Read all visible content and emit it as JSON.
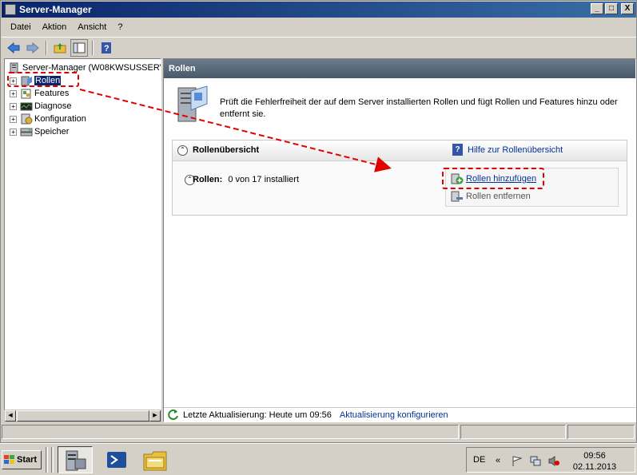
{
  "window": {
    "title": "Server-Manager",
    "controls": {
      "minimize": "_",
      "maximize": "□",
      "close": "X"
    }
  },
  "menu": {
    "items": [
      "Datei",
      "Aktion",
      "Ansicht",
      "?"
    ]
  },
  "toolbar": {
    "icons": [
      "back-arrow-icon",
      "forward-arrow-icon",
      "up-folder-icon",
      "console-tree-icon",
      "help-icon"
    ]
  },
  "tree": {
    "root": "Server-Manager (W08KWSUSSERV",
    "items": [
      {
        "label": "Rollen",
        "icon": "roles-icon",
        "expander": "+",
        "selected": true
      },
      {
        "label": "Features",
        "icon": "features-icon",
        "expander": "+"
      },
      {
        "label": "Diagnose",
        "icon": "diagnose-icon",
        "expander": "+"
      },
      {
        "label": "Konfiguration",
        "icon": "configuration-icon",
        "expander": "+"
      },
      {
        "label": "Speicher",
        "icon": "storage-icon",
        "expander": "+"
      }
    ]
  },
  "main": {
    "header": "Rollen",
    "intro": "Prüft die Fehlerfreiheit der auf dem Server installierten Rollen und fügt Rollen und Features hinzu oder entfernt sie.",
    "summary": {
      "collapse_glyph": "⌃",
      "title": "Rollenübersicht",
      "help_glyph": "?",
      "help_link": "Hilfe zur Rollenübersicht",
      "roles_label": "Rollen:",
      "roles_value": "0 von 17 installiert",
      "actions": {
        "add": "Rollen hinzufügen",
        "remove": "Rollen entfernen"
      }
    },
    "status": {
      "last_update": "Letzte Aktualisierung: Heute um 09:56",
      "configure_link": "Aktualisierung konfigurieren"
    }
  },
  "taskbar": {
    "start_label": "Start",
    "apps": [
      "server-manager-icon",
      "powershell-icon",
      "explorer-icon"
    ],
    "language": "DE",
    "expand_glyph": "«",
    "time": "09:56",
    "date": "02.11.2013"
  },
  "colors": {
    "annotation": "#e00000",
    "title_bar": "#0a246a",
    "link": "#003399",
    "header_bg": "#5a6b7c"
  }
}
